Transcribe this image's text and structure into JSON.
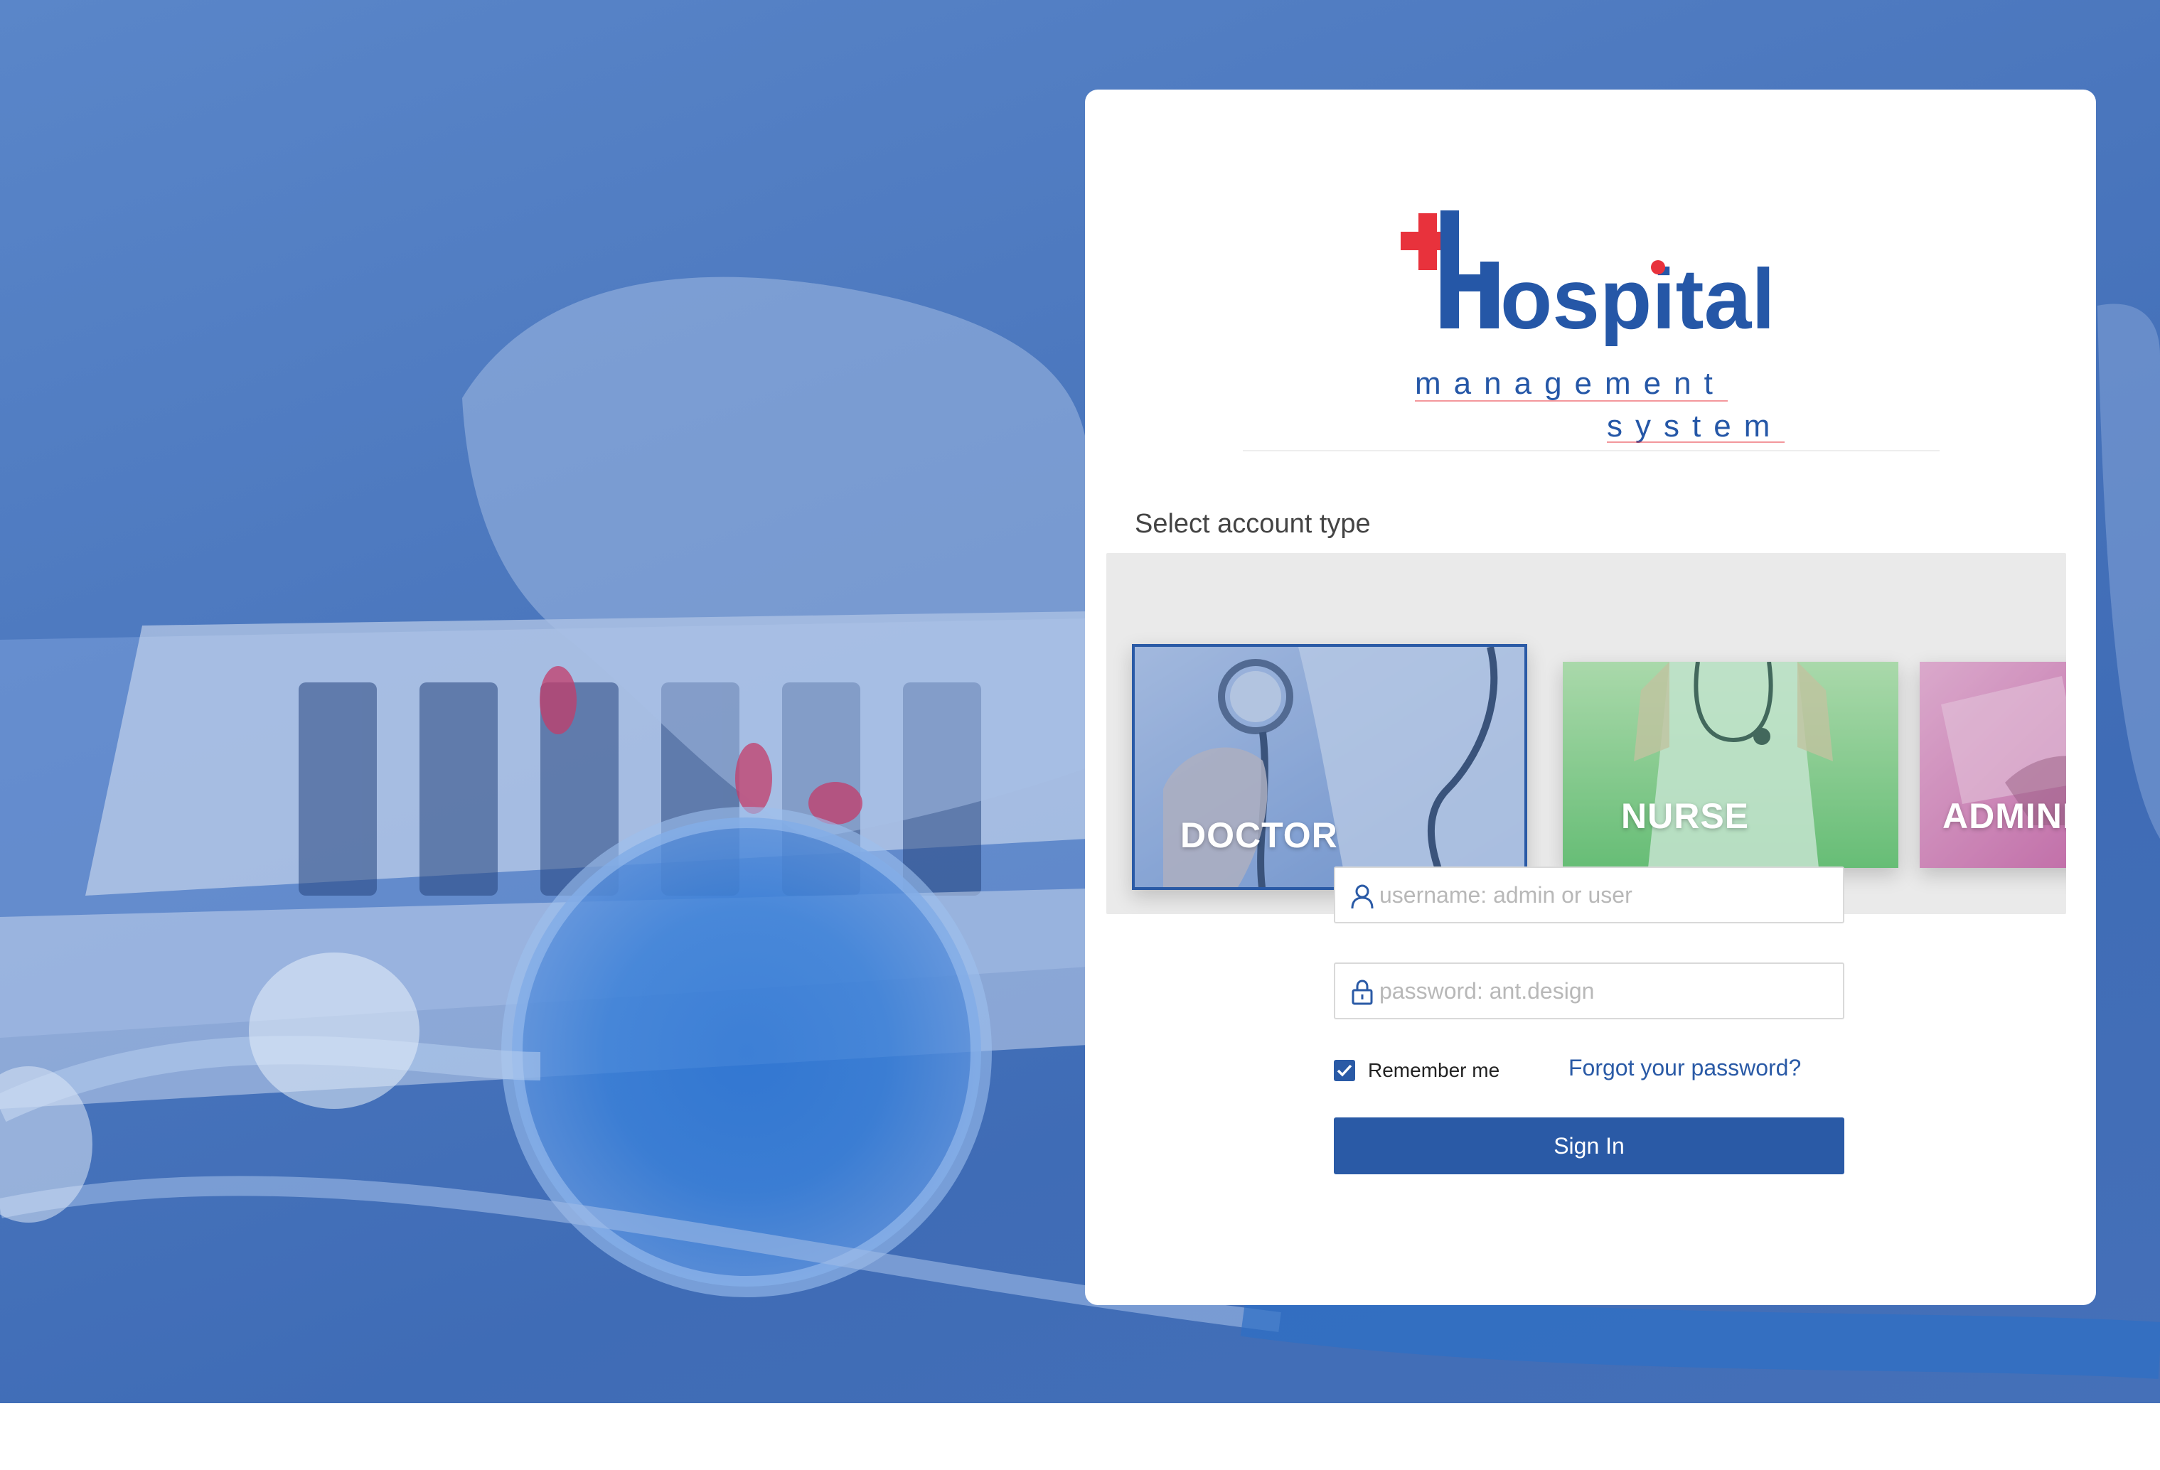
{
  "brand": {
    "logo_word": "Hospital",
    "logo_line2": "management",
    "logo_line3": "system",
    "colors": {
      "primary": "#2a5aa6",
      "cross": "#e8323c",
      "logo_blue": "#2557a7"
    }
  },
  "account_type": {
    "label": "Select account type",
    "options": [
      {
        "label": "DOCTOR",
        "selected": true
      },
      {
        "label": "NURSE",
        "selected": false
      },
      {
        "label": "ADMINIS",
        "selected": false
      }
    ]
  },
  "form": {
    "username_placeholder": "username: admin or user",
    "password_placeholder": "password: ant.design",
    "remember_label": "Remember me",
    "remember_checked": true,
    "forgot_label": "Forgot your password?",
    "submit_label": "Sign In"
  },
  "icons": {
    "username": "user-icon",
    "password": "lock-icon",
    "checkbox": "check-icon"
  }
}
